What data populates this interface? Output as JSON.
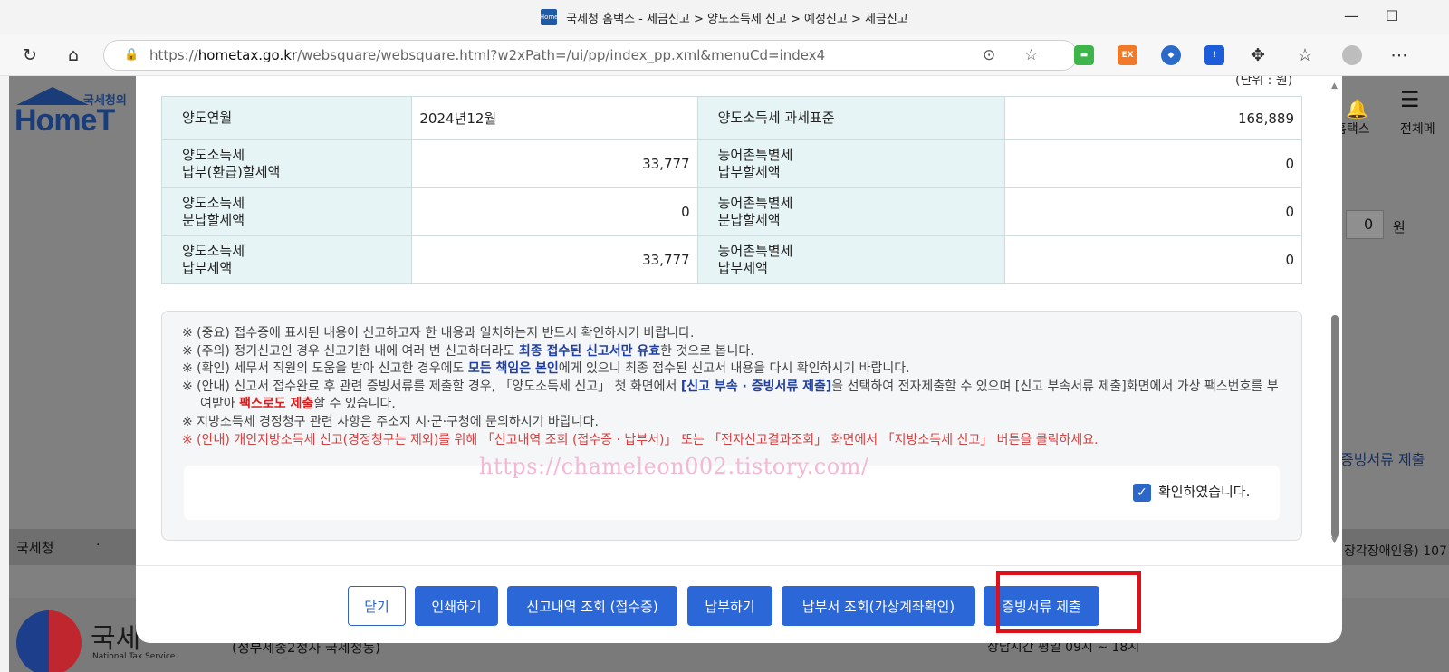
{
  "window": {
    "title": "국세청 홈택스 - 세금신고 > 양도소득세 신고 > 예정신고 > 세금신고",
    "favicon_text": "Home"
  },
  "browser": {
    "url_prefix": "https://",
    "url_host": "hometax.go.kr",
    "url_path": "/websquare/websquare.html?w2xPath=/ui/pp/index_pp.xml&menuCd=index4",
    "ext_ex_label": "EX"
  },
  "background": {
    "logo_small": "국세청의",
    "logo_word": "HomeT",
    "right_top_label1": "홈택스",
    "right_top_label2": "전체메",
    "right_zero": "0",
    "right_won": "원",
    "right_link": "증빙서류 제출",
    "footer_left": "국세청",
    "footer_dot": "·",
    "footer_right": "장각장애인용) 107",
    "bottom_nts": "국세",
    "bottom_nts_en": "National Tax Service",
    "bottom_addr": "(정부세종2청사 국세청동)",
    "bottom_hours": "상담시간 평일 09시 ~ 18시"
  },
  "modal": {
    "unit_label": "(단위 : 원)",
    "table": [
      {
        "th1": "양도연월",
        "v1": "2024년12월",
        "th2": "양도소득세 과세표준",
        "v2": "168,889"
      },
      {
        "th1": "양도소득세\n납부(환급)할세액",
        "v1": "33,777",
        "th2": "농어촌특별세\n납부할세액",
        "v2": "0"
      },
      {
        "th1": "양도소득세\n분납할세액",
        "v1": "0",
        "th2": "농어촌특별세\n분납할세액",
        "v2": "0"
      },
      {
        "th1": "양도소득세\n납부세액",
        "v1": "33,777",
        "th2": "농어촌특별세\n납부세액",
        "v2": "0"
      }
    ],
    "notices": {
      "n1": "※ (중요) 접수증에 표시된 내용이 신고하고자 한 내용과 일치하는지 반드시 확인하시기 바랍니다.",
      "n2_a": "※ (주의) 정기신고인 경우 신고기한 내에 여러 번 신고하더라도 ",
      "n2_b": "최종 접수된 신고서만 유효",
      "n2_c": "한 것으로 봅니다.",
      "n3_a": "※ (확인) 세무서 직원의 도움을 받아 신고한 경우에도 ",
      "n3_b": "모든 책임은 본인",
      "n3_c": "에게 있으니 최종 접수된 신고서 내용을 다시 확인하시기 바랍니다.",
      "n4_a": "※ (안내) 신고서 접수완료 후 관련 증빙서류를 제출할 경우, 「양도소득세 신고」 첫 화면에서 ",
      "n4_b": "[신고 부속 · 증빙서류 제출]",
      "n4_c": "을 선택하여 전자제출할 수 있으며 [신고 부속서류 제출]화면에서 가상 팩스번호를 부여받아 ",
      "n4_d": "팩스로도 제출",
      "n4_e": "할 수 있습니다.",
      "n5": "※ 지방소득세 경정청구 관련 사항은 주소지 시·군·구청에 문의하시기 바랍니다.",
      "n6": "※ (안내) 개인지방소득세 신고(경정청구는 제외)를 위해 「신고내역 조회 (접수증 · 납부서)」 또는 「전자신고결과조회」 화면에서 「지방소득세 신고」 버튼을 클릭하세요."
    },
    "watermark": "https://chameleon002.tistory.com/",
    "confirm_label": "확인하였습니다.",
    "confirm_checked": true,
    "buttons": {
      "close": "닫기",
      "print": "인쇄하기",
      "receipt": "신고내역 조회 (접수증)",
      "pay": "납부하기",
      "bill": "납부서 조회(가상계좌확인)",
      "evidence": "증빙서류 제출"
    }
  },
  "colors": {
    "primary": "#2b67d6",
    "highlight": "#e0101a",
    "table_header_bg": "#e6f4f5"
  }
}
